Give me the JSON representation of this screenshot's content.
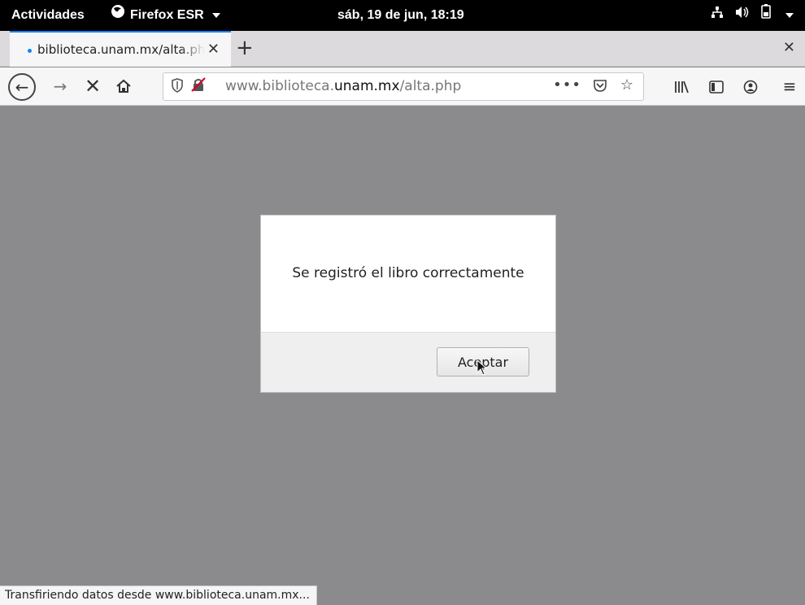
{
  "topbar": {
    "activities": "Actividades",
    "app_name": "Firefox ESR",
    "clock": "sáb, 19 de jun, 18:19"
  },
  "tab": {
    "title": "biblioteca.unam.mx/alta.php"
  },
  "urlbar": {
    "prefix": "www.biblioteca.",
    "domain": "unam.mx",
    "path": "/alta.php"
  },
  "dialog": {
    "message": "Se registró el libro correctamente",
    "accept_label": "Aceptar"
  },
  "status": {
    "text": "Transfiriendo datos desde www.biblioteca.unam.mx..."
  },
  "colors": {
    "accent": "#0a84ff",
    "page_overlay": "#8b8a8c"
  }
}
